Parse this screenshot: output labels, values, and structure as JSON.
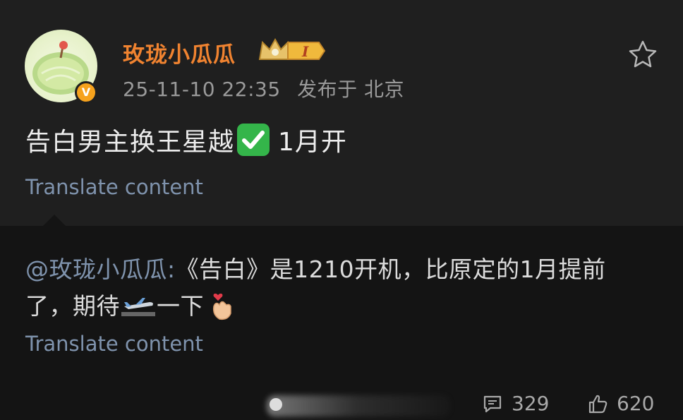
{
  "post": {
    "username": "玫珑小瓜瓜",
    "level_badge": "I",
    "verified_badge": "V",
    "timestamp": "25-11-10 22:35",
    "location": "发布于 北京",
    "text_before_emoji": "告白男主换王星越",
    "text_after_emoji": "1月开",
    "translate_label": "Translate content",
    "icons": {
      "avatar": "avatar-melon",
      "crown": "crown-icon",
      "favorite": "star-icon",
      "check": "check-mark-emoji"
    }
  },
  "repost": {
    "mention": "@玫珑小瓜瓜:",
    "text_line1": "《告白》是1210开机，比原定的1月提前",
    "text_line2_before": "了，期待",
    "text_line2_after": "一下",
    "translate_label": "Translate content",
    "icons": {
      "plane": "airplane-emoji",
      "hand": "finger-heart-emoji"
    }
  },
  "actions": {
    "comments": "329",
    "likes": "620",
    "icons": {
      "share": "share-icon",
      "comment": "comment-icon",
      "like": "thumbs-up-icon"
    }
  },
  "colors": {
    "username": "#f08330",
    "link": "#7f93ad",
    "background": "#1f1f1f",
    "repost_background": "#141414",
    "check": "#34b54a"
  }
}
